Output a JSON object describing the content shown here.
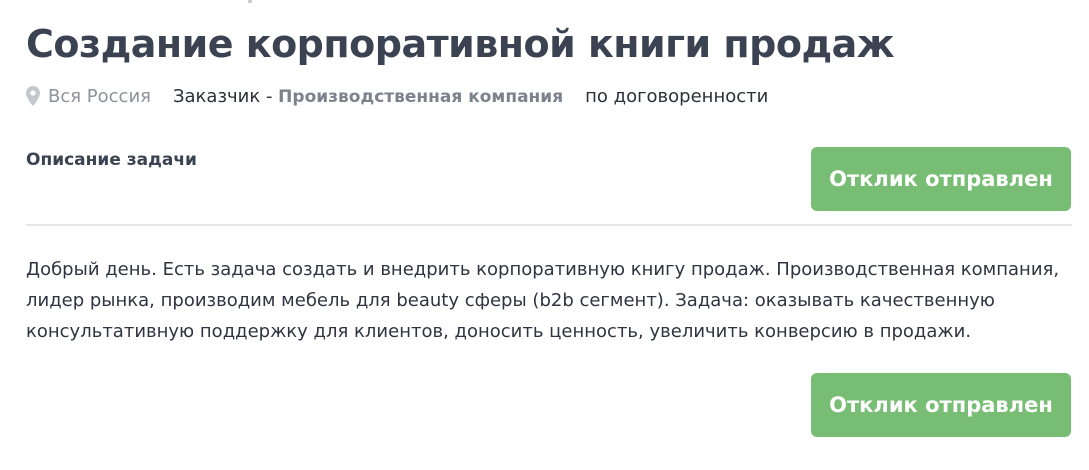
{
  "job": {
    "title": "Создание корпоративной книги продаж",
    "location": "Вся Россия",
    "customer_prefix": "Заказчик - ",
    "customer_name": "Производственная компания",
    "price": "по договоренности"
  },
  "section": {
    "heading": "Описание задачи"
  },
  "description": {
    "text": "Добрый день. Есть задача создать и внедрить корпоративную книгу продаж. Производственная компания, лидер рынка, производим мебель для beauty сферы (b2b сегмент). Задача: оказывать качественную консультативную поддержку для клиентов, доносить ценность, увеличить конверсию в продажи."
  },
  "buttons": {
    "response_top": "Отклик отправлен",
    "response_bottom": "Отклик отправлен"
  },
  "icons": {
    "location": "map-pin-icon"
  },
  "colors": {
    "accent_green": "#77bd74",
    "title_text": "#3b4352",
    "muted_text": "#8d929b",
    "divider": "#e4e6ea"
  }
}
